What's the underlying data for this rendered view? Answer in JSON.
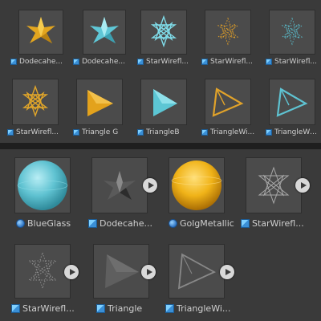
{
  "top_grid": {
    "items": [
      {
        "label": "Dodecahe...",
        "icon": "dodecahedron-gold-icon"
      },
      {
        "label": "Dodecahe...",
        "icon": "dodecahedron-glass-icon"
      },
      {
        "label": "StarWirefl...",
        "icon": "star-wireframe-blue-icon"
      },
      {
        "label": "StarWirefl...",
        "icon": "star-wireframe-gold-dots-icon"
      },
      {
        "label": "StarWirefl...",
        "icon": "star-wireframe-blue-dots-icon"
      },
      {
        "label": "StarWirefl...",
        "icon": "star-wireframe-gold-icon"
      },
      {
        "label": "Triangle G",
        "icon": "triangle-gold-icon"
      },
      {
        "label": "TriangleB",
        "icon": "triangle-blue-icon"
      },
      {
        "label": "TriangleWi...",
        "icon": "triangle-wire-gold-icon"
      },
      {
        "label": "TriangleWi...",
        "icon": "triangle-wire-blue-icon"
      }
    ]
  },
  "bottom_grid": {
    "items": [
      {
        "label": "BlueGlass",
        "icon": "blue-glass-sphere-icon"
      },
      {
        "label": "Dodecahe...",
        "icon": "dodecahedron-gray-icon"
      },
      {
        "label": "GolgMetallic",
        "icon": "gold-metallic-sphere-icon"
      },
      {
        "label": "StarWirefl...",
        "icon": "star-wireframe-gray-icon"
      },
      {
        "label": "StarWirefl...",
        "icon": "star-wireframe-dots-gray-icon"
      },
      {
        "label": "Triangle",
        "icon": "triangle-gray-icon"
      },
      {
        "label": "TriangleWi...",
        "icon": "triangle-wire-gray-icon"
      }
    ]
  },
  "colors": {
    "background": "#3a3a3a",
    "thumb_bg": "#4b4b4b",
    "label": "#cfcfcf",
    "gold": "#e6a817",
    "cyan": "#5ec8d8"
  }
}
